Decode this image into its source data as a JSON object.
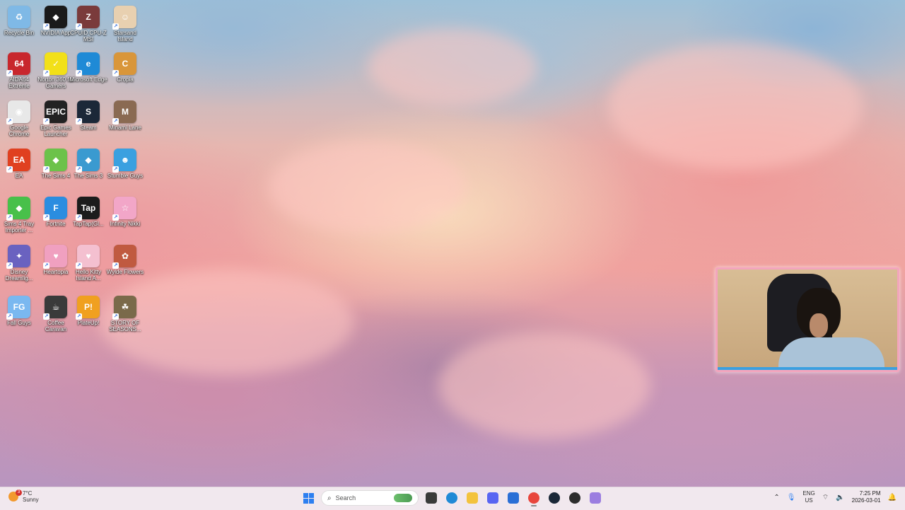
{
  "desktop": {
    "icons": [
      {
        "label": "Recycle Bin",
        "color": "#7fb9e6",
        "glyph": "♻"
      },
      {
        "label": "NVIDIA App",
        "color": "#1a1a1a",
        "glyph": "◆"
      },
      {
        "label": "CPUID CPU-Z MSI",
        "color": "#7a3b3b",
        "glyph": "Z"
      },
      {
        "label": "Starsand Island",
        "color": "#e8d0b0",
        "glyph": "☺"
      },
      {
        "label": "AIDA64 Extreme",
        "color": "#c8272d",
        "glyph": "64"
      },
      {
        "label": "Norton 360 for Gamers",
        "color": "#f2e018",
        "glyph": "✓"
      },
      {
        "label": "Microsoft Edge",
        "color": "#1f8ad6",
        "glyph": "e"
      },
      {
        "label": "Cropia",
        "color": "#d9963a",
        "glyph": "C"
      },
      {
        "label": "Google Chrome",
        "color": "#e8e8e8",
        "glyph": "◉"
      },
      {
        "label": "Epic Games Launcher",
        "color": "#222222",
        "glyph": "EPIC"
      },
      {
        "label": "Steam",
        "color": "#1b2838",
        "glyph": "S"
      },
      {
        "label": "Minami Lane",
        "color": "#8a6a52",
        "glyph": "M"
      },
      {
        "label": "EA",
        "color": "#e04020",
        "glyph": "EA"
      },
      {
        "label": "The Sims 4",
        "color": "#6cc24a",
        "glyph": "◆"
      },
      {
        "label": "The Sims 3",
        "color": "#3a9ad0",
        "glyph": "◆"
      },
      {
        "label": "Stumble Guys",
        "color": "#3aa0e0",
        "glyph": "☻"
      },
      {
        "label": "Sims 4 Tray Importer ...",
        "color": "#48c04a",
        "glyph": "◆"
      },
      {
        "label": "Fortnite",
        "color": "#2b8de0",
        "glyph": "F"
      },
      {
        "label": "TapTap(Gl...",
        "color": "#1c1c1c",
        "glyph": "Tap"
      },
      {
        "label": "Infinity Nikki",
        "color": "#f2a6c8",
        "glyph": "☆"
      },
      {
        "label": "Disney Dreamlig...",
        "color": "#6a62c0",
        "glyph": "✦"
      },
      {
        "label": "Heartopia",
        "color": "#f0a0c0",
        "glyph": "♥"
      },
      {
        "label": "Hello Kitty Island A...",
        "color": "#f4c0d0",
        "glyph": "♥"
      },
      {
        "label": "Wylde Flowers",
        "color": "#c05a40",
        "glyph": "✿"
      },
      {
        "label": "Fall Guys",
        "color": "#7ab8f0",
        "glyph": "FG"
      },
      {
        "label": "Coffee Caravan",
        "color": "#3a3a3a",
        "glyph": "☕"
      },
      {
        "label": "PlateUp!",
        "color": "#f0a020",
        "glyph": "P!"
      },
      {
        "label": "STORY OF SEASONS...",
        "color": "#7a6a4a",
        "glyph": "☘"
      }
    ]
  },
  "taskbar": {
    "weather": {
      "temp": "7°C",
      "condition": "Sunny",
      "badge": "3"
    },
    "search_placeholder": "Search",
    "apps": [
      {
        "name": "task-view",
        "color": "#3a3a3a"
      },
      {
        "name": "edge",
        "color": "#1f8ad6"
      },
      {
        "name": "file-explorer",
        "color": "#f3c33d"
      },
      {
        "name": "discord",
        "color": "#5865f2"
      },
      {
        "name": "microsoft-store",
        "color": "#2a6fd6"
      },
      {
        "name": "chrome",
        "color": "#e8453c"
      },
      {
        "name": "steam",
        "color": "#1b2838"
      },
      {
        "name": "obs-app",
        "color": "#2d2d2d"
      },
      {
        "name": "twitch-studio",
        "color": "#9b7de0"
      }
    ],
    "tray": {
      "language": "ENG",
      "region": "US",
      "time": "7:25 PM",
      "date": "2026-03-01"
    }
  }
}
